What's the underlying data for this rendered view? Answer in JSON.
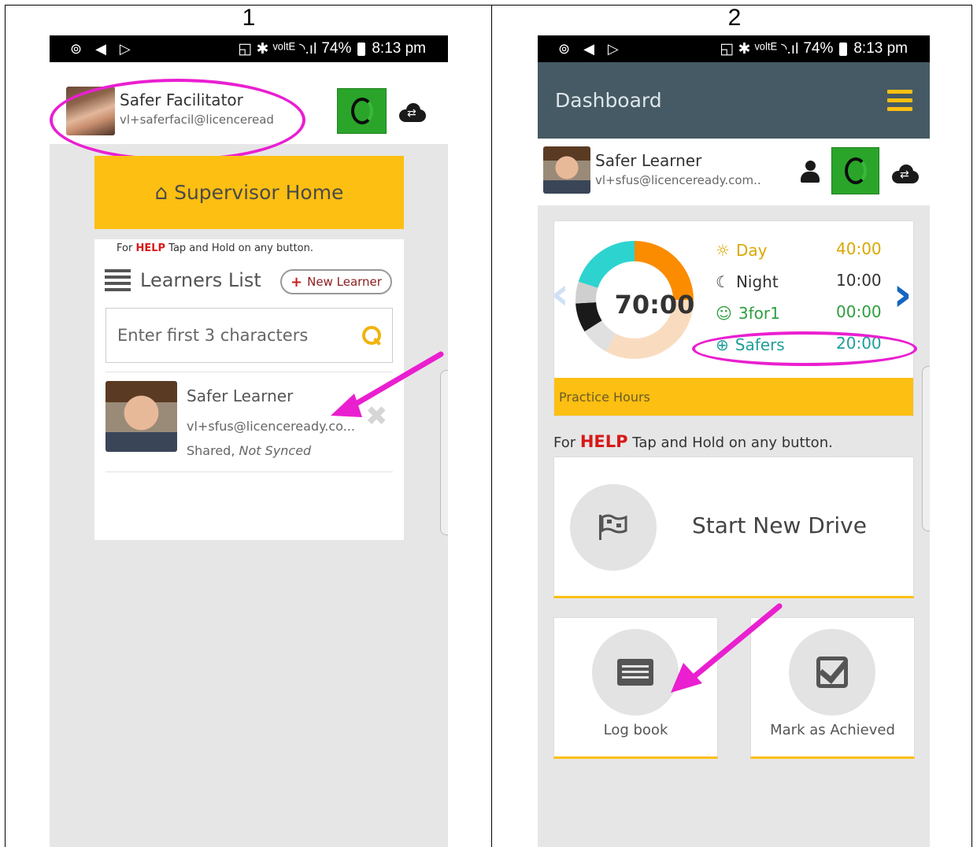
{
  "panels": {
    "left_number": "1",
    "right_number": "2"
  },
  "status_bar": {
    "left_icons": "⊚ ◀ ▷",
    "signal_icons": "◱ ✱ ᵛᵒˡᵗᴱ ◝.ıl",
    "battery": "74%",
    "time": "8:13 pm"
  },
  "panel1": {
    "user": {
      "name": "Safer Facilitator",
      "email": "vl+saferfacil@licenceread"
    },
    "supervisor_home": "Supervisor Home",
    "help": {
      "prefix": "For",
      "keyword": "HELP",
      "suffix": "Tap and Hold on any button."
    },
    "learners_list_title": "Learners List",
    "new_learner_label": "New Learner",
    "search_placeholder": "Enter first 3 characters",
    "learner": {
      "name": "Safer Learner",
      "email": "vl+sfus@licenceready.co...",
      "status_shared": "Shared,",
      "status_sync": "Not Synced"
    }
  },
  "panel2": {
    "title": "Dashboard",
    "user": {
      "name": "Safer Learner",
      "email": "vl+sfus@licenceready.com.."
    },
    "total_hours": "70:00",
    "legend": [
      {
        "label": "Day",
        "value": "40:00",
        "color": "#f0b410",
        "value_color": "#d9a800"
      },
      {
        "label": "Night",
        "value": "10:00",
        "color": "#333333",
        "value_color": "#333333"
      },
      {
        "label": "3for1",
        "value": "00:00",
        "color": "#2e9e3e",
        "value_color": "#2e9e3e"
      },
      {
        "label": "Safers",
        "value": "20:00",
        "color": "#1f9e9a",
        "value_color": "#1f9e9a"
      }
    ],
    "donut_segments": [
      {
        "name": "Day",
        "fraction": 0.25,
        "color": "#fb8c00"
      },
      {
        "name": "Safers",
        "fraction": 0.33,
        "color": "#f9dcc0"
      },
      {
        "name": "Other",
        "fraction": 0.08,
        "color": "#e0e0e0"
      },
      {
        "name": "Night",
        "fraction": 0.08,
        "color": "#1a1a1a"
      },
      {
        "name": "Grey",
        "fraction": 0.06,
        "color": "#cfcfcf"
      },
      {
        "name": "Teal",
        "fraction": 0.2,
        "color": "#2dd4cf"
      }
    ],
    "practice_hours_label": "Practice Hours",
    "help": {
      "prefix": "For",
      "keyword": "HELP",
      "suffix": "Tap and Hold on any button."
    },
    "start_drive_label": "Start New Drive",
    "log_book_label": "Log book",
    "mark_achieved_label": "Mark as Achieved"
  },
  "colors": {
    "accent_yellow": "#fcbf12",
    "sync_green": "#2aa52a",
    "annotation_magenta": "#ea1fd0",
    "topbar": "#455a64"
  }
}
